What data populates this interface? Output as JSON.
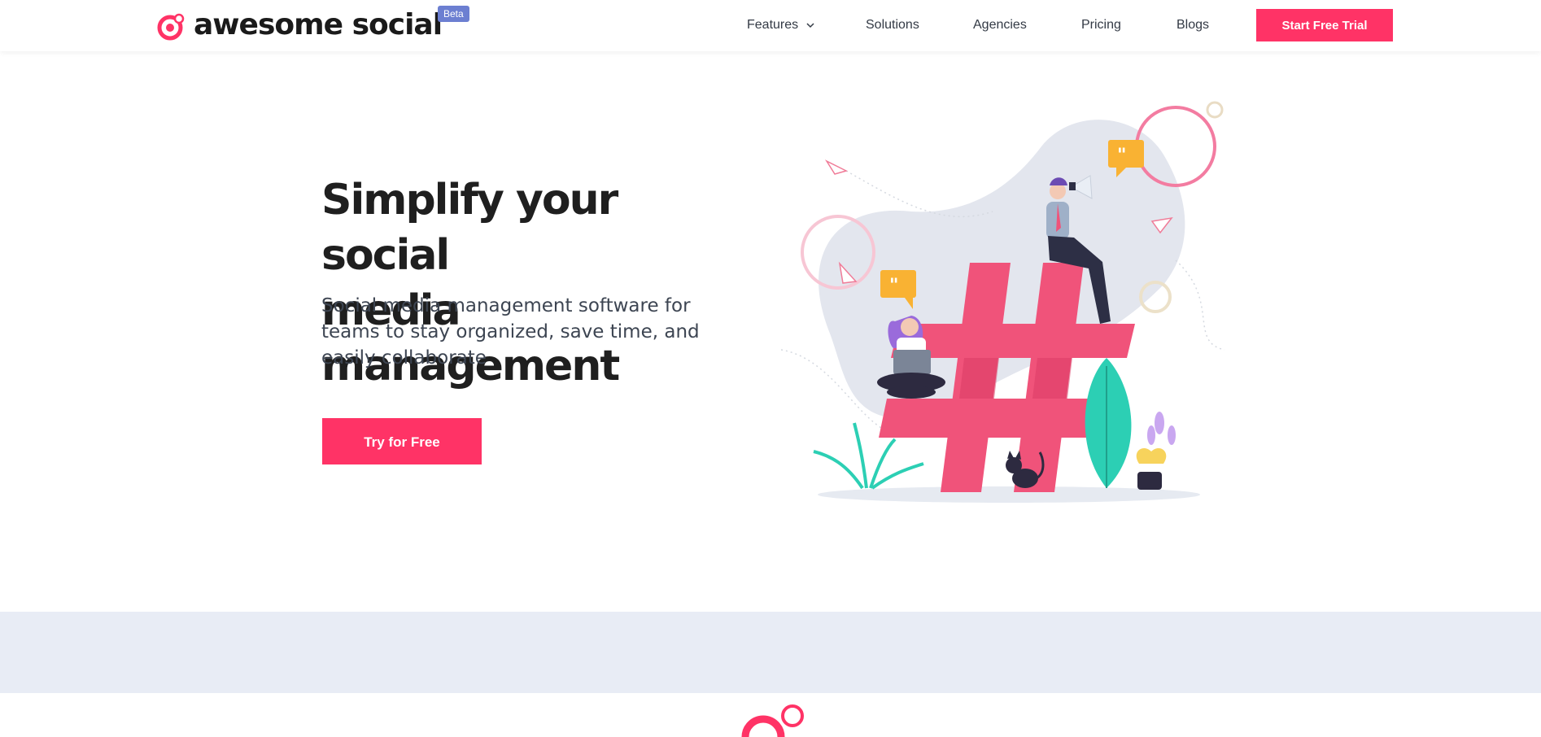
{
  "header": {
    "brand": "awesome social",
    "beta": "Beta",
    "nav": [
      {
        "label": "Features",
        "has_dropdown": true
      },
      {
        "label": "Solutions"
      },
      {
        "label": "Agencies"
      },
      {
        "label": "Pricing"
      },
      {
        "label": "Blogs"
      }
    ],
    "cta_label": "Start Free Trial"
  },
  "hero": {
    "title_line1": "Simplify your social",
    "title_line2": "media management",
    "subtitle": "Social media management software for teams to stay organized, save time, and easily collaborate",
    "cta_label": "Try for Free"
  },
  "colors": {
    "accent": "#ff3366",
    "beta_badge": "#6c7fd1",
    "band": "#e8ecf5",
    "leaf": "#2ccfb4",
    "speech_bubble": "#f9b233"
  },
  "icons": [
    "awesome-social-logo-icon",
    "chevron-down-icon",
    "hashtag-illustration"
  ]
}
